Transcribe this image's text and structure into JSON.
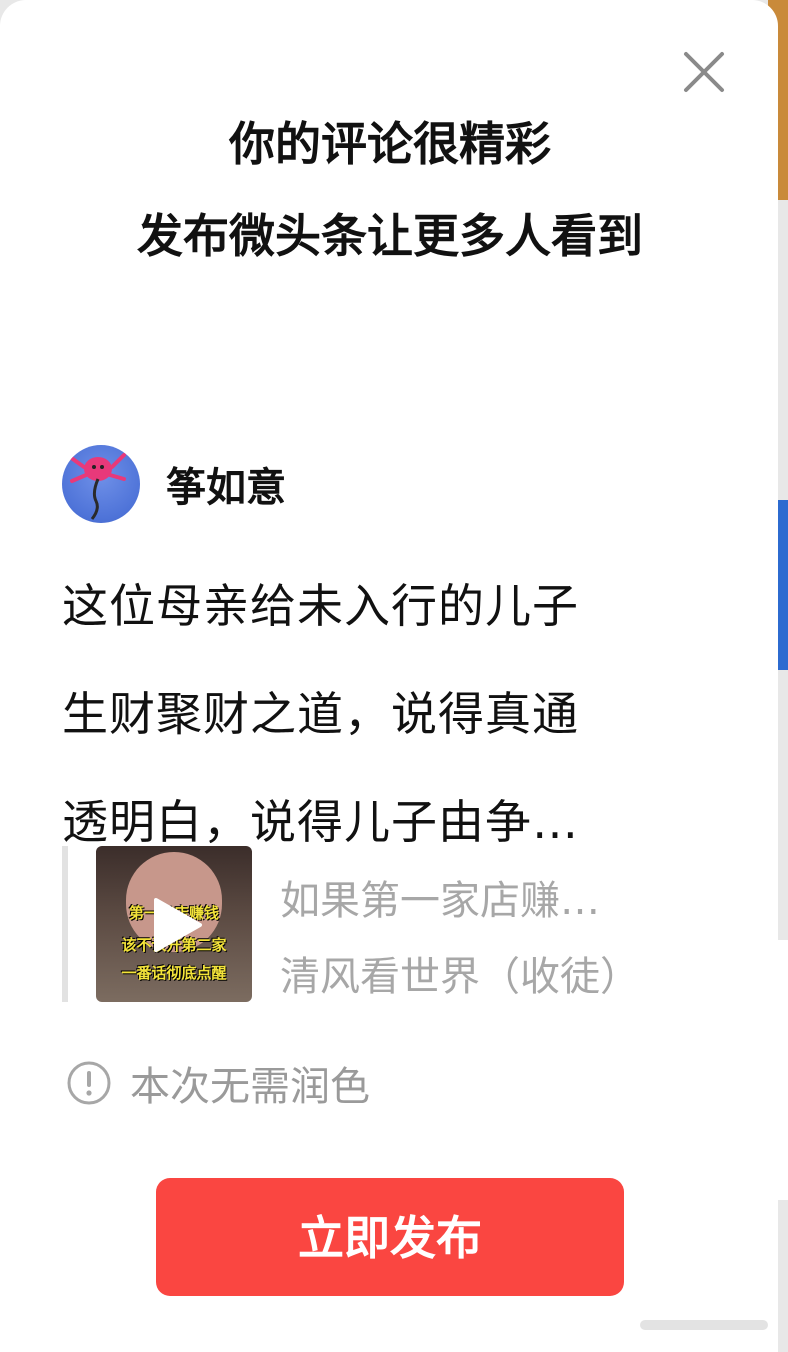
{
  "dialog": {
    "title_line1": "你的评论很精彩",
    "title_line2": "发布微头条让更多人看到",
    "close_icon": "close-icon"
  },
  "author": {
    "name": "筝如意",
    "avatar_icon": "kite-avatar"
  },
  "comment": {
    "lines": [
      "这位母亲给未入行的儿子",
      "生财聚财之道，说得真通",
      "透明白，说得儿子由争…"
    ]
  },
  "quoted_video": {
    "title": "如果第一家店赚…",
    "author": "清风看世界（收徒）",
    "thumbnail_lines": [
      "第一家店赚钱",
      "该不该开第二家",
      "一番话彻底点醒"
    ],
    "play_icon": "play-icon"
  },
  "notice": {
    "icon": "info-icon",
    "text": "本次无需润色"
  },
  "publish_button": {
    "label": "立即发布"
  },
  "colors": {
    "accent": "#fa4641",
    "muted_text": "#a7a7a7",
    "title_text": "#111111"
  }
}
